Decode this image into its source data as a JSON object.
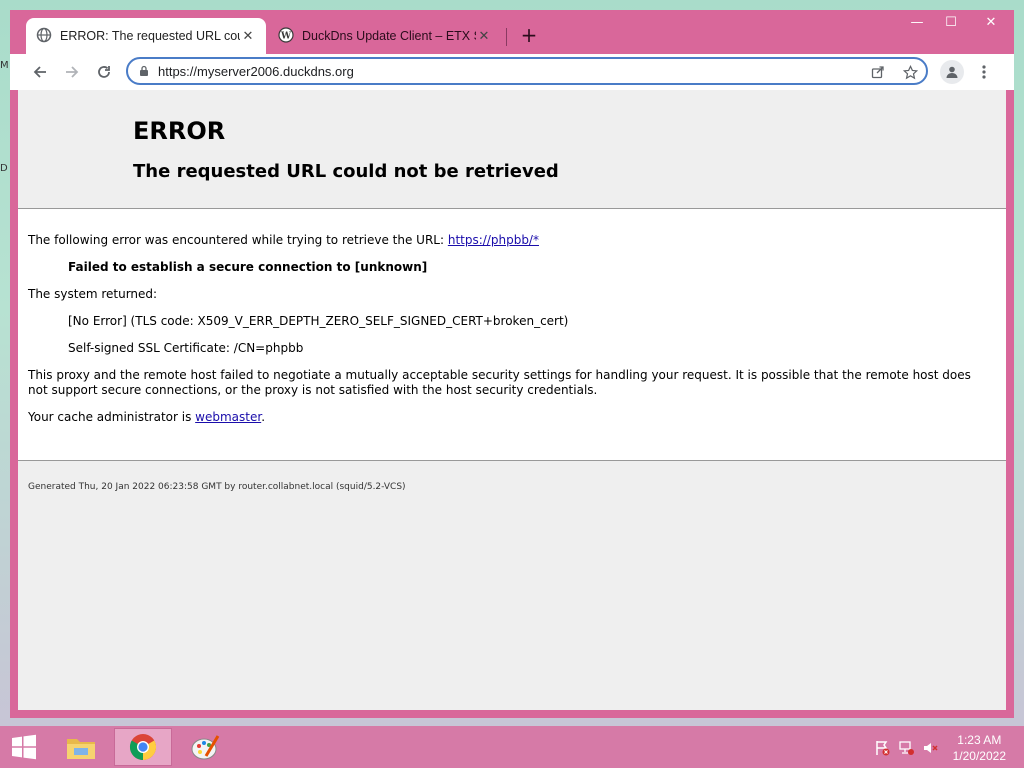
{
  "desktop": {
    "edge_labels": [
      "M",
      "D"
    ]
  },
  "browser": {
    "window_controls": {
      "minimize": "—",
      "maximize": "☐",
      "close": "✕"
    },
    "tabs": [
      {
        "title": "ERROR: The requested URL could not be retrieved",
        "close": "✕",
        "active": true
      },
      {
        "title": "DuckDns Update Client – ETX Software",
        "close": "✕",
        "active": false
      }
    ],
    "new_tab": "+",
    "address": {
      "url": "https://myserver2006.duckdns.org"
    }
  },
  "page": {
    "title": "ERROR",
    "subtitle": "The requested URL could not be retrieved",
    "line1_prefix": "The following error was encountered while trying to retrieve the URL: ",
    "line1_link": "https://phpbb/*",
    "failure": "Failed to establish a secure connection to [unknown]",
    "system_returned": "The system returned:",
    "tls_code": "[No Error] (TLS code: X509_V_ERR_DEPTH_ZERO_SELF_SIGNED_CERT+broken_cert)",
    "certificate": "Self-signed SSL Certificate: /CN=phpbb",
    "explanation": "This proxy and the remote host failed to negotiate a mutually acceptable security settings for handling your request. It is possible that the remote host does not support secure connections, or the proxy is not satisfied with the host security credentials.",
    "admin_prefix": "Your cache administrator is ",
    "admin_link": "webmaster",
    "admin_suffix": ".",
    "generated": "Generated Thu, 20 Jan 2022 06:23:58 GMT by router.collabnet.local (squid/5.2-VCS)"
  },
  "taskbar": {
    "time": "1:23 AM",
    "date": "1/20/2022",
    "apps": [
      "file-explorer",
      "chrome",
      "paint"
    ]
  }
}
